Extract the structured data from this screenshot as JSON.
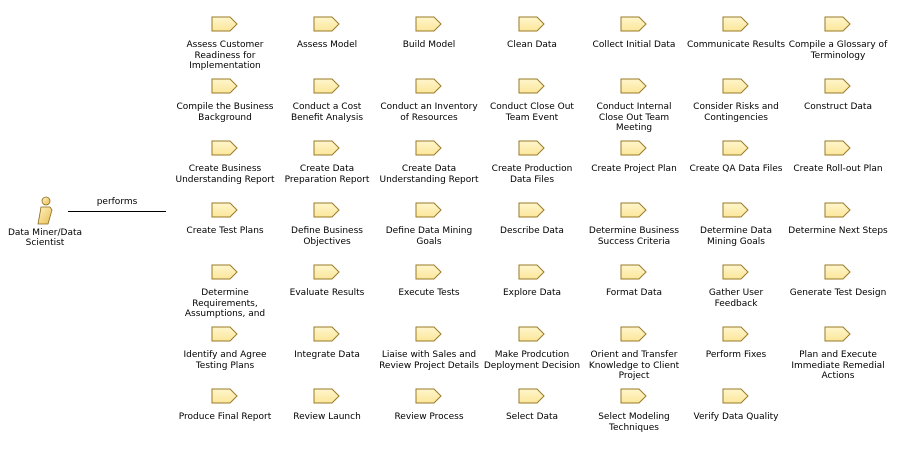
{
  "actor": {
    "label": "Data Miner/Data Scientist",
    "icon": "actor-person-icon",
    "colors": {
      "fill": "#f5d97a",
      "stroke": "#8a6a1e"
    }
  },
  "relation": {
    "label": "performs"
  },
  "task_icon": {
    "icon": "task-tag-icon",
    "colors": {
      "fill": "#fbe69a",
      "stroke": "#9a7a28"
    }
  },
  "tasks": [
    "Assess Customer Readiness for Implementation",
    "Assess Model",
    "Build Model",
    "Clean Data",
    "Collect Initial Data",
    "Communicate Results",
    "Compile a Glossary of Terminology",
    "Compile the Business Background",
    "Conduct a Cost Benefit Analysis",
    "Conduct an Inventory of Resources",
    "Conduct Close Out Team Event",
    "Conduct Internal Close Out Team Meeting",
    "Consider Risks and Contingencies",
    "Construct Data",
    "Create Business Understanding Report",
    "Create Data Preparation Report",
    "Create Data Understanding Report",
    "Create Production Data Files",
    "Create Project Plan",
    "Create QA Data Files",
    "Create Roll-out Plan",
    "Create Test Plans",
    "Define Business Objectives",
    "Define Data Mining Goals",
    "Describe Data",
    "Determine Business Success Criteria",
    "Determine Data Mining Goals",
    "Determine Next Steps",
    "Determine Requirements, Assumptions, and",
    "Evaluate Results",
    "Execute Tests",
    "Explore Data",
    "Format Data",
    "Gather User Feedback",
    "Generate Test Design",
    "Identify and Agree Testing Plans",
    "Integrate Data",
    "Liaise with Sales and Review Project Details",
    "Make Prodcution Deployment Decision",
    "Orient and Transfer Knowledge to Client Project",
    "Perform Fixes",
    "Plan and Execute Immediate Remedial Actions",
    "Produce Final Report",
    "Review Launch",
    "Review Process",
    "Select Data",
    "Select Modeling Techniques",
    "Verify Data Quality"
  ]
}
